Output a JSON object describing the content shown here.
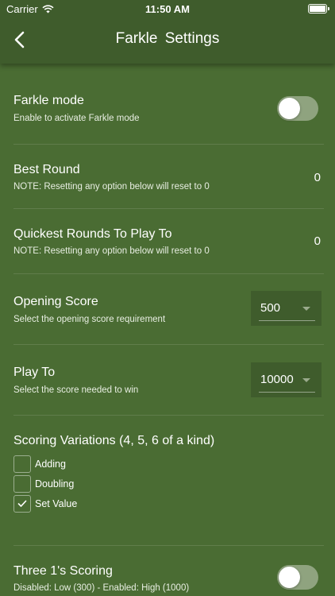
{
  "status_bar": {
    "carrier": "Carrier",
    "time": "11:50 AM"
  },
  "nav": {
    "title": "Farkle  Settings"
  },
  "settings": {
    "farkle_mode": {
      "title": "Farkle mode",
      "subtitle": "Enable to activate Farkle mode",
      "enabled": false
    },
    "best_round": {
      "title": "Best Round",
      "subtitle": "NOTE: Resetting any option below will reset to 0",
      "value": "0"
    },
    "quickest_rounds": {
      "title": "Quickest Rounds To Play To",
      "subtitle": "NOTE: Resetting any option below will reset to 0",
      "value": "0"
    },
    "opening_score": {
      "title": "Opening Score",
      "subtitle": "Select the opening score requirement",
      "selected": "500"
    },
    "play_to": {
      "title": "Play To",
      "subtitle": "Select the score needed to win",
      "selected": "10000"
    },
    "scoring_variations": {
      "title": "Scoring Variations (4, 5, 6 of a kind)",
      "options": [
        {
          "label": "Adding",
          "checked": false
        },
        {
          "label": "Doubling",
          "checked": false
        },
        {
          "label": "Set Value",
          "checked": true
        }
      ]
    },
    "three_ones": {
      "title": "Three 1's Scoring",
      "subtitle": "Disabled: Low (300) - Enabled: High (1000)",
      "enabled": false
    }
  },
  "colors": {
    "background": "#4a6c33",
    "header": "#3f5c2c",
    "toggle_off": "#8fa37f",
    "text": "#ffffff"
  }
}
